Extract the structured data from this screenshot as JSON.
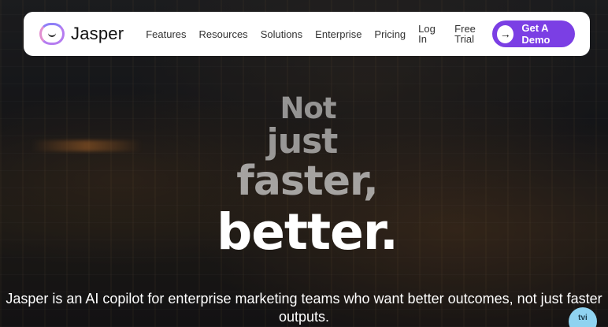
{
  "brand": {
    "name": "Jasper",
    "logo_icon": "jasper-smile-logo"
  },
  "nav": {
    "links": [
      "Features",
      "Resources",
      "Solutions",
      "Enterprise",
      "Pricing"
    ],
    "login": "Log In",
    "trial": "Free Trial",
    "cta": {
      "label": "Get A Demo",
      "icon": "arrow-right-icon"
    }
  },
  "hero": {
    "line1": "Not",
    "line2": "just",
    "line3": "faster,",
    "line4": "better.",
    "subtext": "Jasper is an AI copilot for enterprise marketing teams who want better outcomes, not just faster outputs."
  },
  "chat": {
    "label": "tvi"
  },
  "colors": {
    "accent": "#7b3fe4",
    "nav_bg": "#ffffff"
  }
}
